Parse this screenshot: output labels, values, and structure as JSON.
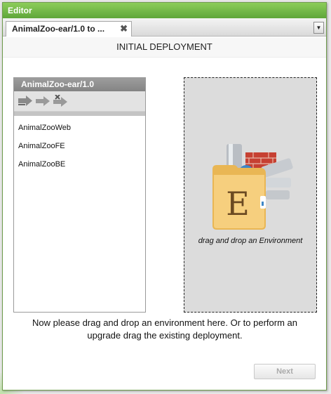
{
  "window": {
    "title": "Editor"
  },
  "tabs": [
    {
      "label": "AnimalZoo-ear/1.0 to ...",
      "close_glyph": "✖"
    }
  ],
  "tab_menu_glyph": "▼",
  "header": {
    "title": "INITIAL DEPLOYMENT"
  },
  "application": {
    "title": "AnimalZoo-ear/1.0",
    "toolbar": [
      "deploy-arrow-icon",
      "move-arrow-icon",
      "remove-arrow-icon"
    ],
    "modules": [
      "AnimalZooWeb",
      "AnimalZooFE",
      "AnimalZooBE"
    ]
  },
  "dropzone": {
    "icon": "environment-folder-icon",
    "letter": "E",
    "caption": "drag and drop an Environment"
  },
  "instructions": {
    "line1": "Now please drag and drop an environment here. Or to perform an",
    "line2": "upgrade drag the existing deployment."
  },
  "footer": {
    "next_label": "Next",
    "next_enabled": false
  },
  "colors": {
    "titlebar": "#6fb246",
    "panel_header": "#8f8f8f",
    "dropzone_bg": "#dcdcdc",
    "folder": "#f1c46a"
  }
}
